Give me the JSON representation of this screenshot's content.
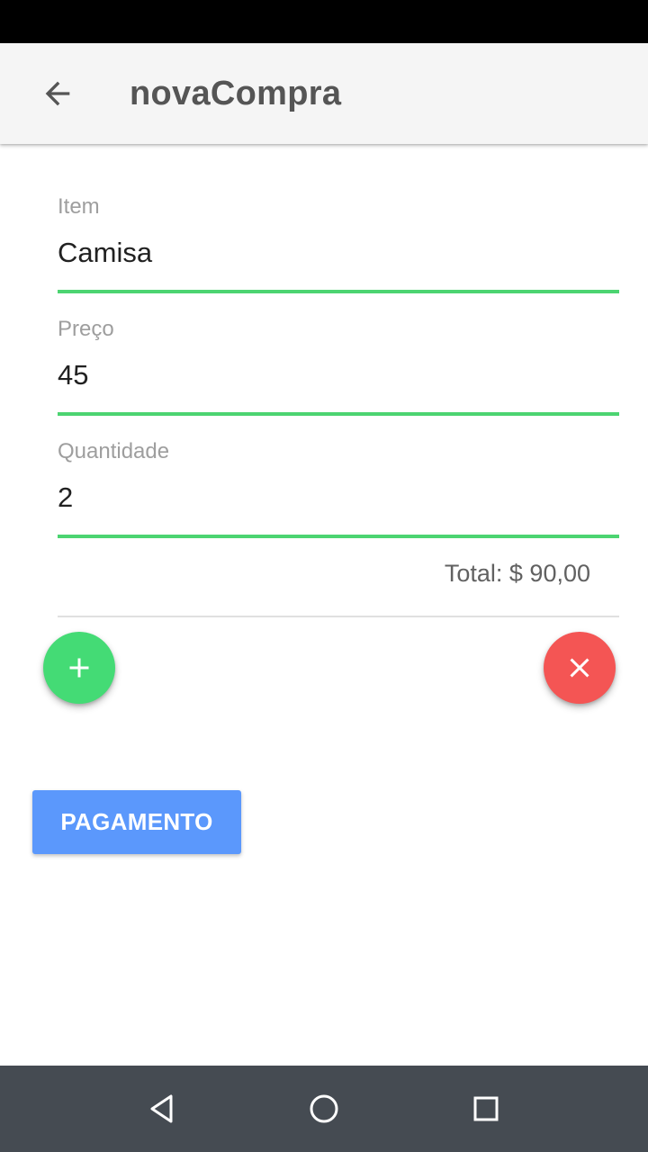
{
  "app_bar": {
    "title": "novaCompra",
    "back_icon": "arrow-left-icon"
  },
  "form": {
    "item": {
      "label": "Item",
      "value": "Camisa"
    },
    "preco": {
      "label": "Preço",
      "value": "45"
    },
    "quantidade": {
      "label": "Quantidade",
      "value": "2"
    }
  },
  "summary": {
    "total_text": "Total: $ 90,00"
  },
  "actions": {
    "add_icon": "plus-icon",
    "cancel_icon": "close-icon",
    "payment_label": "PAGAMENTO"
  },
  "nav": {
    "back_icon": "triangle-back-icon",
    "home_icon": "circle-home-icon",
    "recents_icon": "square-recents-icon"
  },
  "colors": {
    "underline": "#4cd471",
    "add_fab": "#44db75",
    "cancel_fab": "#f45554",
    "payment_button": "#5b98fc",
    "app_bar": "#f5f5f5",
    "nav_bar": "#454b52"
  }
}
